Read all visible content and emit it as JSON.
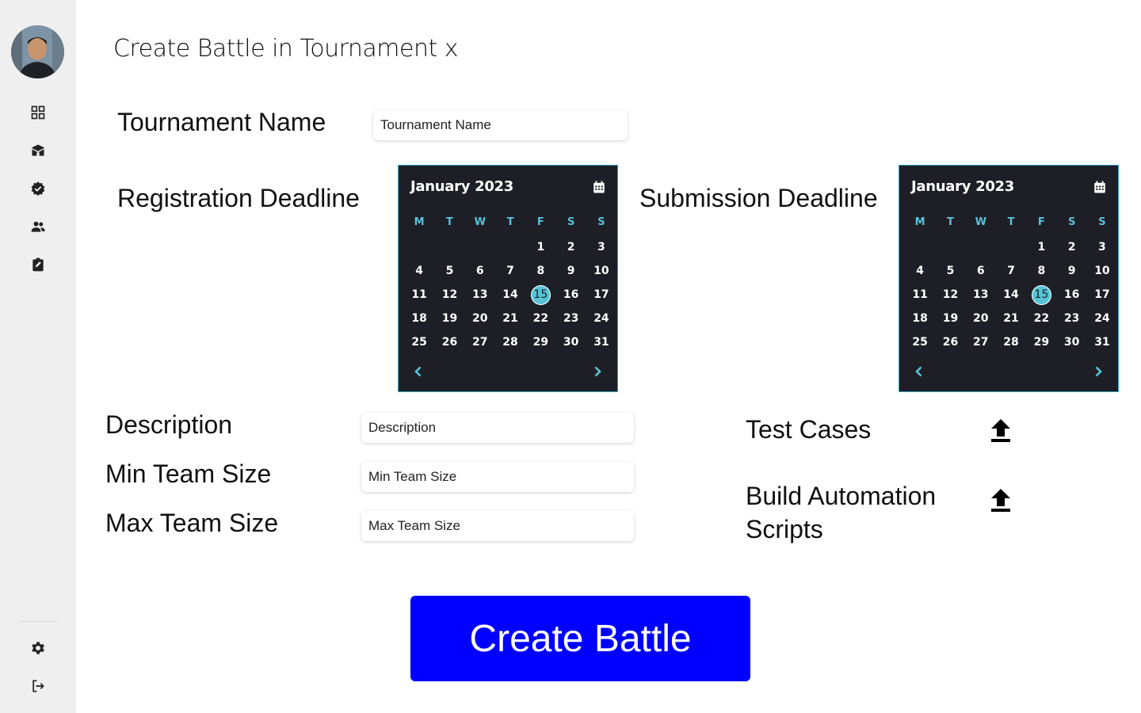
{
  "page": {
    "title": "Create Battle in Tournament x"
  },
  "sidebar": {
    "items": [
      {
        "icon": "dashboard-icon"
      },
      {
        "icon": "school-icon"
      },
      {
        "icon": "verified-badge-icon"
      },
      {
        "icon": "people-icon"
      },
      {
        "icon": "assignment-icon"
      }
    ],
    "bottom": [
      {
        "icon": "gear-icon"
      },
      {
        "icon": "logout-icon"
      }
    ]
  },
  "form": {
    "tournament_name": {
      "label": "Tournament Name",
      "placeholder": "Tournament Name",
      "value": ""
    },
    "registration_deadline": {
      "label": "Registration Deadline"
    },
    "submission_deadline": {
      "label": "Submission Deadline"
    },
    "description": {
      "label": "Description",
      "placeholder": "Description",
      "value": ""
    },
    "min_team_size": {
      "label": "Min Team Size",
      "placeholder": "Min Team Size",
      "value": ""
    },
    "max_team_size": {
      "label": "Max Team Size",
      "placeholder": "Max Team Size",
      "value": ""
    },
    "test_cases": {
      "label": "Test Cases",
      "icon": "upload-icon"
    },
    "build_scripts": {
      "label_line1": "Build Automation",
      "label_line2": "Scripts",
      "icon": "upload-icon"
    }
  },
  "calendars": {
    "registration": {
      "month_label": "January 2023",
      "weekdays": [
        "M",
        "T",
        "W",
        "T",
        "F",
        "S",
        "S"
      ],
      "leading_blanks": 4,
      "days_in_month": 31,
      "selected_day": 15
    },
    "submission": {
      "month_label": "January 2023",
      "weekdays": [
        "M",
        "T",
        "W",
        "T",
        "F",
        "S",
        "S"
      ],
      "leading_blanks": 4,
      "days_in_month": 31,
      "selected_day": 15
    }
  },
  "actions": {
    "create_label": "Create Battle"
  },
  "colors": {
    "sidebar_bg": "#efefef",
    "calendar_bg": "#1e1f26",
    "calendar_accent": "#56c3d6",
    "primary_button": "#0000ff"
  }
}
